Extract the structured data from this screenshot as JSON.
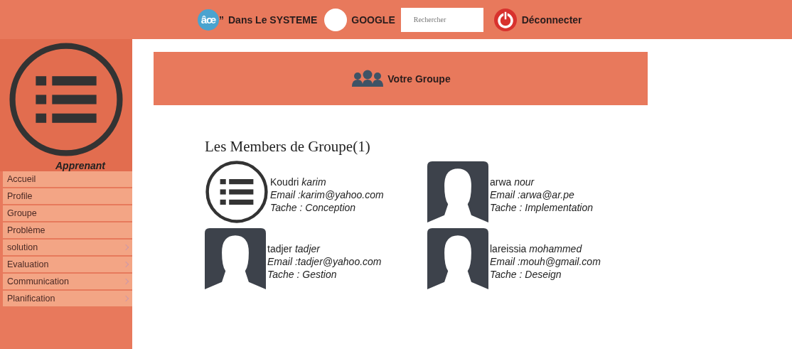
{
  "top_bar": {
    "logo": {
      "text": "âœ",
      "mark": "”"
    },
    "system_link": "Dans Le SYSTEME",
    "google_link": "GOOGLE",
    "search": {
      "placeholder": "Rechercher"
    },
    "logout": "Déconnecter"
  },
  "sidebar": {
    "role": "Apprenant",
    "items": [
      {
        "label": "Accueil",
        "has_submenu": false
      },
      {
        "label": "Profile",
        "has_submenu": false
      },
      {
        "label": "Groupe",
        "has_submenu": false
      },
      {
        "label": "Problème",
        "has_submenu": false
      },
      {
        "label": "solution",
        "has_submenu": true
      },
      {
        "label": "Evaluation",
        "has_submenu": true
      },
      {
        "label": "Communication",
        "has_submenu": true
      },
      {
        "label": "Planification",
        "has_submenu": true
      }
    ]
  },
  "banner": {
    "title": "Votre Groupe"
  },
  "members_title": "Les Members de Groupe(1)",
  "members": [
    {
      "kind": "list",
      "last_name": "Koudri",
      "first_name": "karim",
      "email": "Email :karim@yahoo.com",
      "task": "Tache :  Conception"
    },
    {
      "kind": "silhouette",
      "last_name": "arwa",
      "first_name": "nour",
      "email": "Email :arwa@ar.pe",
      "task": "Tache :  Implementation"
    },
    {
      "kind": "silhouette",
      "last_name": "tadjer",
      "first_name": "tadjer",
      "email": "Email :tadjer@yahoo.com",
      "task": "Tache :  Gestion"
    },
    {
      "kind": "silhouette",
      "last_name": "lareissia",
      "first_name": "mohammed",
      "email": "Email :mouh@gmail.com",
      "task": "Tache :  Deseign"
    }
  ]
}
